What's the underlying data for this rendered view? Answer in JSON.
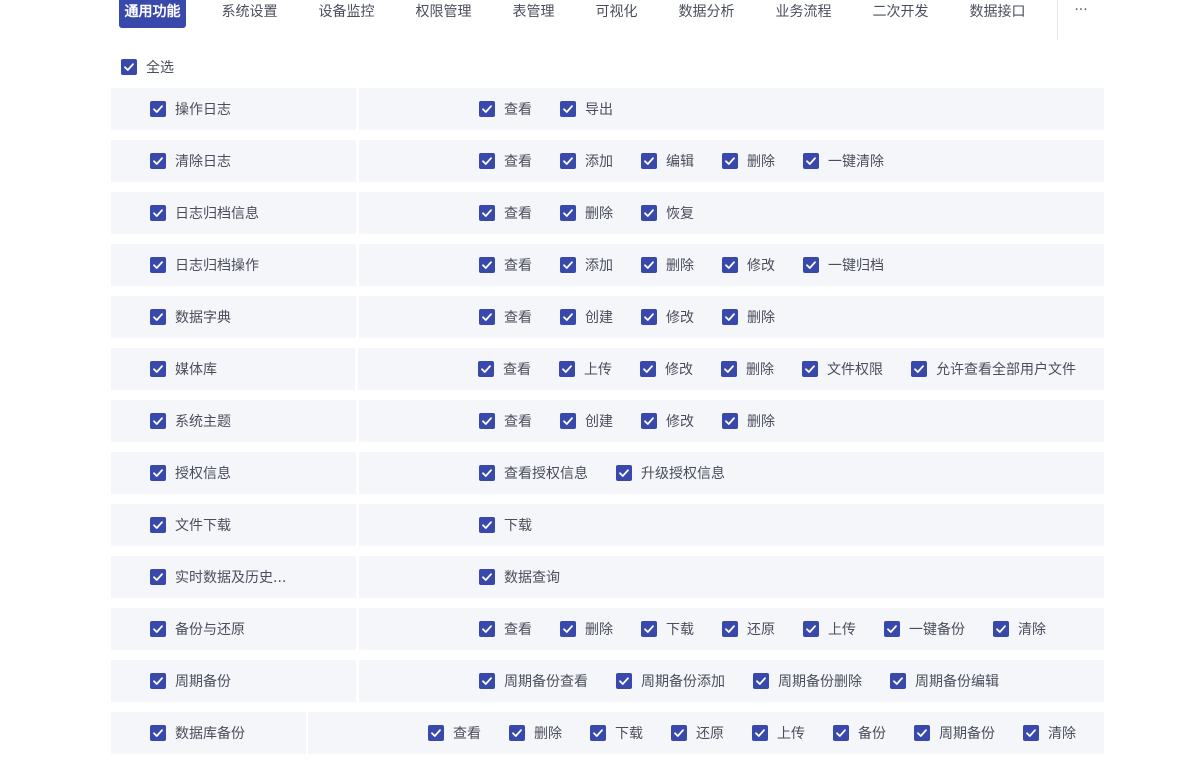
{
  "tabs": [
    {
      "label": "通用功能",
      "active": true
    },
    {
      "label": "系统设置",
      "active": false
    },
    {
      "label": "设备监控",
      "active": false
    },
    {
      "label": "权限管理",
      "active": false
    },
    {
      "label": "表管理",
      "active": false
    },
    {
      "label": "可视化",
      "active": false
    },
    {
      "label": "数据分析",
      "active": false
    },
    {
      "label": "业务流程",
      "active": false
    },
    {
      "label": "二次开发",
      "active": false
    },
    {
      "label": "数据接口",
      "active": false
    }
  ],
  "more_label": "···",
  "select_all_label": "全选",
  "colors": {
    "accent": "#3949ab",
    "row_bg": "#f5f6fa",
    "text": "#4a4e5c"
  },
  "modules": [
    {
      "name": "操作日志",
      "perms": [
        "查看",
        "导出"
      ]
    },
    {
      "name": "清除日志",
      "perms": [
        "查看",
        "添加",
        "编辑",
        "删除",
        "一键清除"
      ]
    },
    {
      "name": "日志归档信息",
      "perms": [
        "查看",
        "删除",
        "恢复"
      ]
    },
    {
      "name": "日志归档操作",
      "perms": [
        "查看",
        "添加",
        "删除",
        "修改",
        "一键归档"
      ]
    },
    {
      "name": "数据字典",
      "perms": [
        "查看",
        "创建",
        "修改",
        "删除"
      ]
    },
    {
      "name": "媒体库",
      "perms": [
        "查看",
        "上传",
        "修改",
        "删除",
        "文件权限",
        "允许查看全部用户文件"
      ]
    },
    {
      "name": "系统主题",
      "perms": [
        "查看",
        "创建",
        "修改",
        "删除"
      ]
    },
    {
      "name": "授权信息",
      "perms": [
        "查看授权信息",
        "升级授权信息"
      ]
    },
    {
      "name": "文件下载",
      "perms": [
        "下载"
      ]
    },
    {
      "name": "实时数据及历史...",
      "perms": [
        "数据查询"
      ]
    },
    {
      "name": "备份与还原",
      "perms": [
        "查看",
        "删除",
        "下载",
        "还原",
        "上传",
        "一键备份",
        "清除"
      ]
    },
    {
      "name": "周期备份",
      "perms": [
        "周期备份查看",
        "周期备份添加",
        "周期备份删除",
        "周期备份编辑"
      ]
    },
    {
      "name": "数据库备份",
      "perms": [
        "查看",
        "删除",
        "下载",
        "还原",
        "上传",
        "备份",
        "周期备份",
        "清除"
      ]
    }
  ]
}
